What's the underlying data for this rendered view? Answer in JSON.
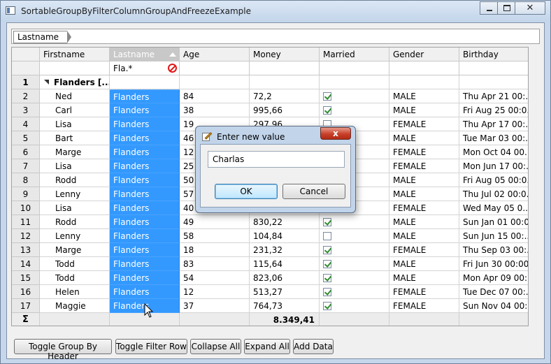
{
  "window": {
    "title": "SortableGroupByFilterColumnGroupAndFreezeExample",
    "minimize_icon": "minimize-icon",
    "maximize_icon": "maximize-icon",
    "close_glyph": "✕"
  },
  "group_by_panel": {
    "chips": [
      "Lastname"
    ]
  },
  "grid": {
    "columns": [
      "Firstname",
      "Lastname",
      "Age",
      "Money",
      "Married",
      "Gender",
      "Birthday"
    ],
    "sorted_column": "Lastname",
    "filter": {
      "lastname": "Fla.*"
    },
    "group_row": {
      "number": "1",
      "label": "Flanders [..."
    },
    "rows": [
      {
        "n": "2",
        "firstname": "Ned",
        "lastname": "Flanders",
        "age": "84",
        "money": "72,2",
        "married": true,
        "gender": "MALE",
        "birthday": "Thu Apr 21 00:..."
      },
      {
        "n": "3",
        "firstname": "Carl",
        "lastname": "Flanders",
        "age": "38",
        "money": "995,66",
        "married": true,
        "gender": "MALE",
        "birthday": "Fri Aug 25 00:0..."
      },
      {
        "n": "4",
        "firstname": "Lisa",
        "lastname": "Flanders",
        "age": "19",
        "money": "297,96",
        "married": false,
        "gender": "FEMALE",
        "birthday": "Thu Apr 17 00:..."
      },
      {
        "n": "5",
        "firstname": "Bart",
        "lastname": "Flanders",
        "age": "46",
        "money": "",
        "married": null,
        "gender": "MALE",
        "birthday": "Tue Mar 03 00:..."
      },
      {
        "n": "6",
        "firstname": "Marge",
        "lastname": "Flanders",
        "age": "12",
        "money": "",
        "married": null,
        "gender": "FEMALE",
        "birthday": "Mon Oct 04 00..."
      },
      {
        "n": "7",
        "firstname": "Lisa",
        "lastname": "Flanders",
        "age": "25",
        "money": "",
        "married": null,
        "gender": "FEMALE",
        "birthday": "Mon Jun 17 00:..."
      },
      {
        "n": "8",
        "firstname": "Rodd",
        "lastname": "Flanders",
        "age": "50",
        "money": "",
        "married": null,
        "gender": "MALE",
        "birthday": "Fri Aug 05 00:0..."
      },
      {
        "n": "9",
        "firstname": "Lenny",
        "lastname": "Flanders",
        "age": "57",
        "money": "",
        "married": null,
        "gender": "MALE",
        "birthday": "Thu Jul 02 00:0..."
      },
      {
        "n": "10",
        "firstname": "Lisa",
        "lastname": "Flanders",
        "age": "40",
        "money": "",
        "married": null,
        "gender": "FEMALE",
        "birthday": "Wed May 05 0..."
      },
      {
        "n": "11",
        "firstname": "Rodd",
        "lastname": "Flanders",
        "age": "49",
        "money": "830,22",
        "married": true,
        "gender": "MALE",
        "birthday": "Sun Jan 01 00:0..."
      },
      {
        "n": "12",
        "firstname": "Lenny",
        "lastname": "Flanders",
        "age": "58",
        "money": "104,84",
        "married": false,
        "gender": "MALE",
        "birthday": "Sun Jun 15 00:..."
      },
      {
        "n": "13",
        "firstname": "Marge",
        "lastname": "Flanders",
        "age": "18",
        "money": "231,32",
        "married": true,
        "gender": "FEMALE",
        "birthday": "Thu Sep 03 00:..."
      },
      {
        "n": "14",
        "firstname": "Todd",
        "lastname": "Flanders",
        "age": "83",
        "money": "115,64",
        "married": true,
        "gender": "MALE",
        "birthday": "Fri Jun 30 00:00..."
      },
      {
        "n": "15",
        "firstname": "Todd",
        "lastname": "Flanders",
        "age": "54",
        "money": "823,06",
        "married": true,
        "gender": "MALE",
        "birthday": "Mon Apr 09 00:..."
      },
      {
        "n": "16",
        "firstname": "Helen",
        "lastname": "Flanders",
        "age": "12",
        "money": "513,27",
        "married": true,
        "gender": "FEMALE",
        "birthday": "Tue Dec 07 00:..."
      },
      {
        "n": "17",
        "firstname": "Maggie",
        "lastname": "Flanders",
        "age": "37",
        "money": "764,73",
        "married": true,
        "gender": "FEMALE",
        "birthday": "Sun Nov 04 00:..."
      }
    ],
    "summary": {
      "symbol": "Σ",
      "money_total": "8.349,41"
    }
  },
  "buttons": [
    "Toggle Group By Header",
    "Toggle Filter Row",
    "Collapse All",
    "Expand All",
    "Add Data"
  ],
  "dialog": {
    "title": "Enter new value",
    "close_glyph": "x",
    "input_value": "Charlas",
    "ok_label": "OK",
    "cancel_label": "Cancel"
  },
  "colors": {
    "selection": "#3399ff",
    "window_frame": "#c6d7ec",
    "filter_clear_icon": "#e01818",
    "checkbox_check": "#2e8b2e"
  }
}
